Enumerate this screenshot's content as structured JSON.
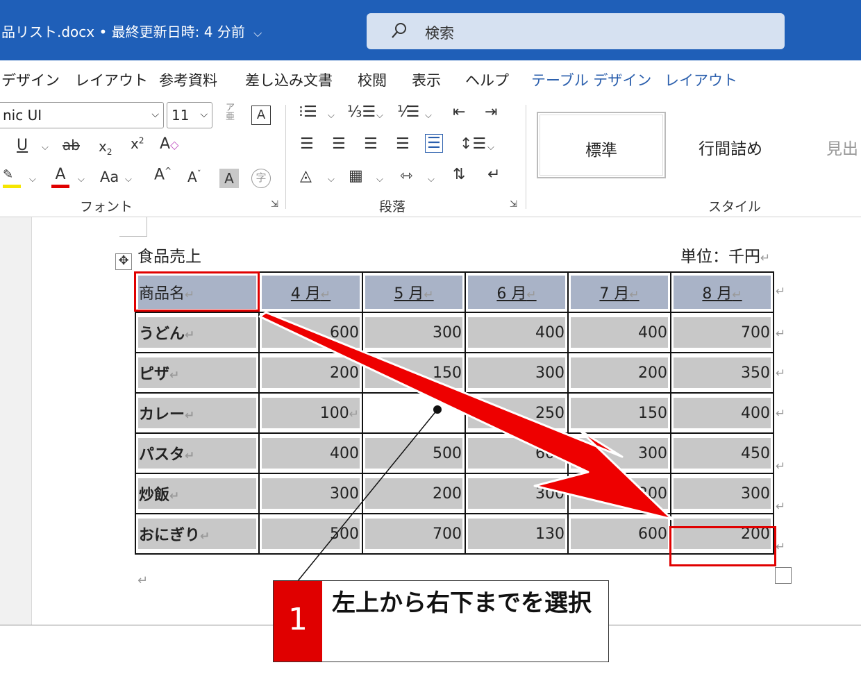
{
  "titlebar": {
    "doc_title": "品リスト.docx • 最終更新日時: 4 分前",
    "search_label": "検索"
  },
  "tabs": [
    {
      "label": "デザイン"
    },
    {
      "label": "レイアウト"
    },
    {
      "label": "参考資料"
    },
    {
      "label": "差し込み文書"
    },
    {
      "label": "校閲"
    },
    {
      "label": "表示"
    },
    {
      "label": "ヘルプ"
    },
    {
      "label": "テーブル デザイン"
    },
    {
      "label": "レイアウト"
    }
  ],
  "ribbon": {
    "font_name": "nic UI",
    "font_size": "11",
    "groups": {
      "font": "フォント",
      "paragraph": "段落",
      "styles": "スタイル"
    },
    "styles": {
      "normal": "標準",
      "no_spacing": "行間詰め",
      "heading": "見出"
    },
    "colors": {
      "highlight": "#f5e600",
      "font_color": "#e00000"
    }
  },
  "document": {
    "caption_left": "食品売上",
    "caption_right": "単位：千円",
    "table": {
      "headers": [
        "商品名",
        "4 月",
        "5 月",
        "6 月",
        "7 月",
        "8 月"
      ],
      "rows": [
        {
          "name": "うどん",
          "values": [
            "600",
            "300",
            "400",
            "400",
            "700"
          ]
        },
        {
          "name": "ピザ",
          "values": [
            "200",
            "150",
            "300",
            "200",
            "350"
          ]
        },
        {
          "name": "カレー",
          "values": [
            "100",
            "",
            "250",
            "150",
            "400"
          ]
        },
        {
          "name": "パスタ",
          "values": [
            "400",
            "500",
            "600",
            "300",
            "450"
          ]
        },
        {
          "name": "炒飯",
          "values": [
            "300",
            "200",
            "300",
            "200",
            "300"
          ]
        },
        {
          "name": "おにぎり",
          "values": [
            "500",
            "700",
            "130",
            "600",
            "200"
          ]
        }
      ]
    }
  },
  "annotation": {
    "step": "1",
    "text": "左上から右下までを選択",
    "color": "#e00000"
  }
}
